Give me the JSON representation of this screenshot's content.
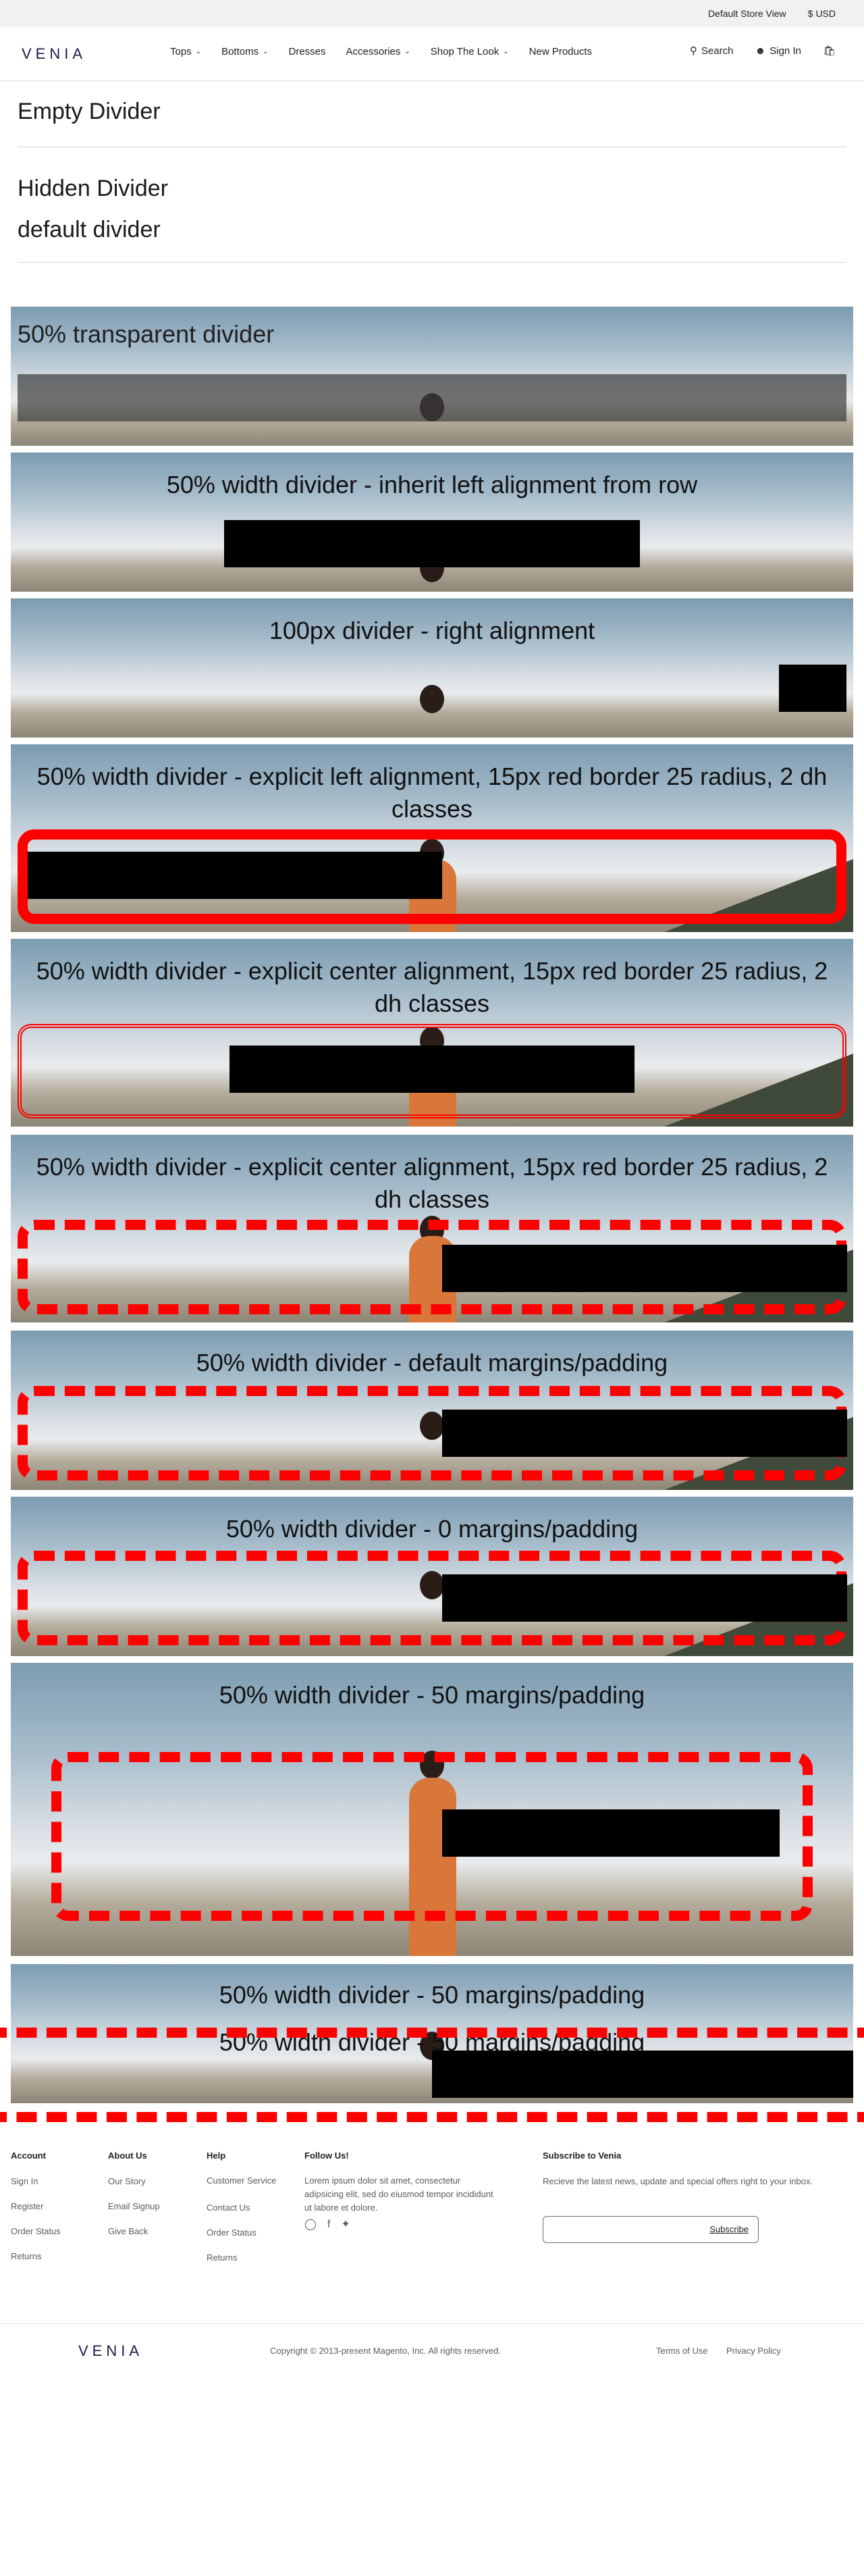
{
  "topbar": {
    "store": "Default Store View",
    "currency": "USD",
    "currency_symbol": "$"
  },
  "header": {
    "logo": "VENIA",
    "nav": [
      "Tops",
      "Bottoms",
      "Dresses",
      "Accessories",
      "Shop The Look",
      "New Products"
    ],
    "nav_chevrons": [
      true,
      true,
      false,
      true,
      true,
      false
    ],
    "search": "Search",
    "signin": "Sign In"
  },
  "headings": {
    "empty": "Empty Divider",
    "hidden": "Hidden Divider",
    "default": "default divider"
  },
  "rows": [
    {
      "title": "50% transparent divider",
      "align": "left"
    },
    {
      "title": "50% width divider - inherit left alignment from row"
    },
    {
      "title": "100px divider - right alignment"
    },
    {
      "title": "50% width divider - explicit left alignment, 15px red border 25 radius, 2 dh classes"
    },
    {
      "title": "50% width divider - explicit center alignment, 15px red border 25 radius, 2 dh classes"
    },
    {
      "title": "50% width divider - explicit center alignment, 15px red border 25 radius, 2 dh classes"
    },
    {
      "title": "50% width divider - default margins/padding"
    },
    {
      "title": "50% width divider - 0 margins/padding"
    },
    {
      "title": "50% width divider - 50 margins/padding"
    },
    {
      "title": "50% width divider - 50 margins/padding"
    }
  ],
  "overlay_title": "50% width divider - 50 margins/padding",
  "footer": {
    "account": {
      "title": "Account",
      "links": [
        "Sign In",
        "Register",
        "Order Status",
        "Returns"
      ]
    },
    "about": {
      "title": "About Us",
      "links": [
        "Our Story",
        "Email Signup",
        "Give Back"
      ]
    },
    "help": {
      "title": "Help",
      "links": [
        "Customer Service",
        "Contact Us",
        "Order Status",
        "Returns"
      ]
    },
    "follow": {
      "title": "Follow Us!",
      "text": "Lorem ipsum dolor sit amet, consectetur adipsicing elit, sed do eiusmod tempor incididunt ut labore et dolore."
    },
    "subscribe": {
      "title": "Subscribe to Venia",
      "text": "Recieve the latest news, update and special offers right to your inbox.",
      "button": "Subscribe",
      "placeholder": ""
    }
  },
  "bottom": {
    "logo": "VENIA",
    "copyright": "Copyright © 2013-present Magento, Inc. All rights reserved.",
    "terms": "Terms of Use",
    "privacy": "Privacy Policy"
  },
  "colors": {
    "accent_red": "#ff0000",
    "topbar_bg": "#f0f1f2"
  }
}
